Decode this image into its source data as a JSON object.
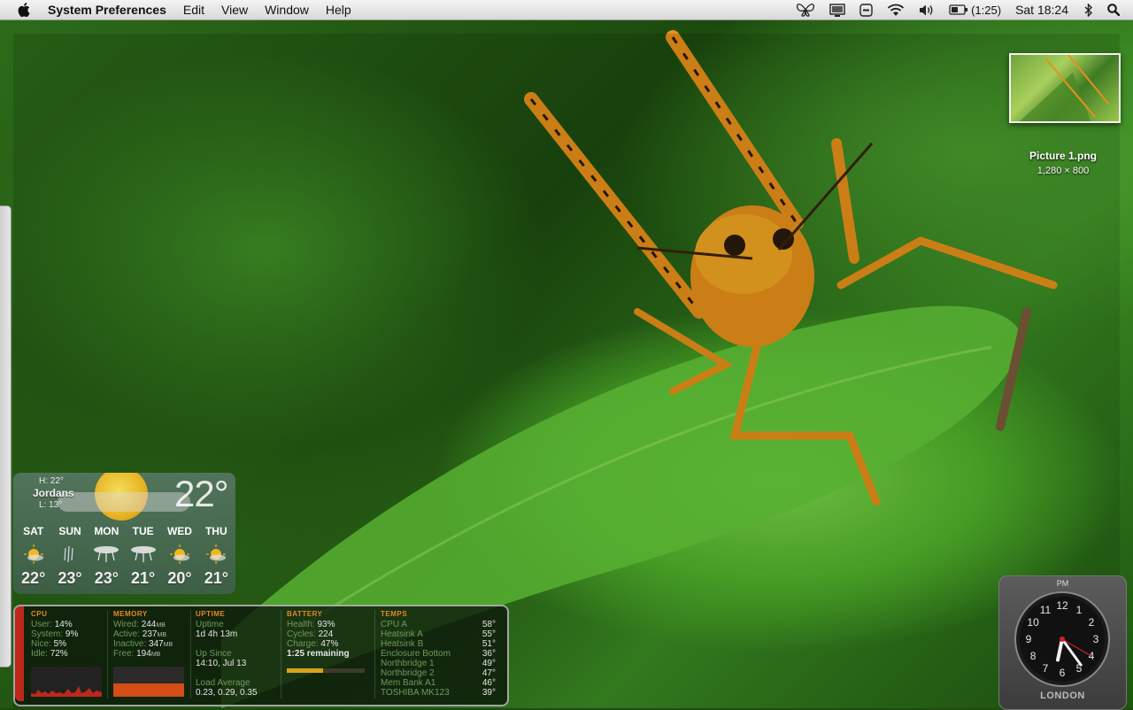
{
  "menubar": {
    "app_name": "System Preferences",
    "menus": [
      "Edit",
      "View",
      "Window",
      "Help"
    ],
    "battery_text": "(1:25)",
    "clock": "Sat 18:24"
  },
  "desktop_file": {
    "name": "Picture 1.png",
    "dimensions": "1,280 × 800"
  },
  "weather": {
    "high": "H: 22°",
    "city": "Jordans",
    "low": "L: 13°",
    "current_temp": "22°",
    "days": [
      {
        "name": "SAT",
        "temp": "22°",
        "icon": "sun-icon"
      },
      {
        "name": "SUN",
        "temp": "23°",
        "icon": "rain-icon"
      },
      {
        "name": "MON",
        "temp": "23°",
        "icon": "storm-icon"
      },
      {
        "name": "TUE",
        "temp": "21°",
        "icon": "storm-icon"
      },
      {
        "name": "WED",
        "temp": "20°",
        "icon": "sun-icon"
      },
      {
        "name": "THU",
        "temp": "21°",
        "icon": "sun-icon"
      }
    ]
  },
  "istat": {
    "cpu": {
      "title": "CPU",
      "rows": [
        {
          "label": "User:",
          "value": "14%"
        },
        {
          "label": "System:",
          "value": "9%"
        },
        {
          "label": "Nice:",
          "value": "5%"
        },
        {
          "label": "Idle:",
          "value": "72%"
        }
      ]
    },
    "memory": {
      "title": "MEMORY",
      "rows": [
        {
          "label": "Wired:",
          "value": "244",
          "unit": "MB"
        },
        {
          "label": "Active:",
          "value": "237",
          "unit": "MB"
        },
        {
          "label": "Inactive:",
          "value": "347",
          "unit": "MB"
        },
        {
          "label": "Free:",
          "value": "194",
          "unit": "MB"
        }
      ]
    },
    "uptime": {
      "title": "UPTIME",
      "uptime_label": "Uptime",
      "uptime_value": "1d 4h 13m",
      "since_label": "Up Since",
      "since_value": "14:10, Jul 13",
      "load_label": "Load Average",
      "load_value": "0.23, 0.29, 0.35"
    },
    "battery": {
      "title": "BATTERY",
      "health_label": "Health:",
      "health_value": "93%",
      "cycles_label": "Cycles:",
      "cycles_value": "224",
      "charge_label": "Charge:",
      "charge_value": "47%",
      "remaining": "1:25 remaining",
      "charge_fraction": 0.47
    },
    "temps": {
      "title": "TEMPS",
      "rows": [
        {
          "label": "CPU A",
          "value": "58°"
        },
        {
          "label": "Heatsink A",
          "value": "55°"
        },
        {
          "label": "Heatsink B",
          "value": "51°"
        },
        {
          "label": "Enclosure Bottom",
          "value": "36°"
        },
        {
          "label": "Northbridge 1",
          "value": "49°"
        },
        {
          "label": "Northbridge 2",
          "value": "47°"
        },
        {
          "label": "Mem Bank A1",
          "value": "46°"
        },
        {
          "label": "TOSHIBA MK123",
          "value": "39°"
        }
      ]
    }
  },
  "world_clock": {
    "ampm": "PM",
    "city": "LONDON",
    "numerals": [
      "12",
      "1",
      "2",
      "3",
      "4",
      "5",
      "6",
      "7",
      "8",
      "9",
      "10",
      "11"
    ],
    "hour": 6,
    "minute": 24
  },
  "colors": {
    "istat_section": "#e6862a",
    "istat_label": "#6f9a5b",
    "battery_fill": "#d9a21a",
    "memory_fill": "#d44c16"
  }
}
